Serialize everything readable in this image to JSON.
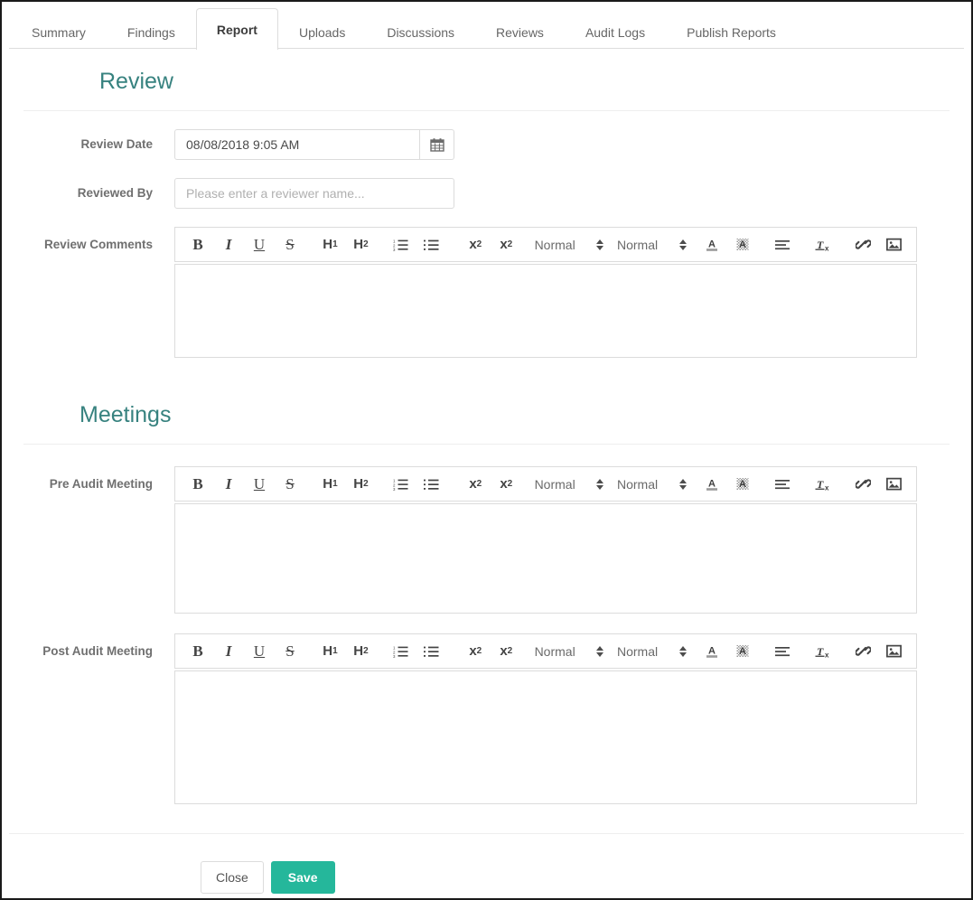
{
  "tabs": [
    {
      "label": "Summary",
      "active": false
    },
    {
      "label": "Findings",
      "active": false
    },
    {
      "label": "Report",
      "active": true
    },
    {
      "label": "Uploads",
      "active": false
    },
    {
      "label": "Discussions",
      "active": false
    },
    {
      "label": "Reviews",
      "active": false
    },
    {
      "label": "Audit Logs",
      "active": false
    },
    {
      "label": "Publish Reports",
      "active": false
    }
  ],
  "review_section": {
    "title": "Review",
    "review_date": {
      "label": "Review Date",
      "value": "08/08/2018 9:05 AM",
      "calendar_icon": "calendar-icon"
    },
    "reviewed_by": {
      "label": "Reviewed By",
      "value": "",
      "placeholder": "Please enter a reviewer name..."
    },
    "review_comments": {
      "label": "Review Comments",
      "value": ""
    }
  },
  "meetings_section": {
    "title": "Meetings",
    "pre_audit_meeting": {
      "label": "Pre Audit Meeting",
      "value": ""
    },
    "post_audit_meeting": {
      "label": "Post Audit Meeting",
      "value": ""
    }
  },
  "editor_toolbar": {
    "bold": "B",
    "italic": "I",
    "underline": "U",
    "strikethrough": "S",
    "heading1": "H",
    "heading1_sub": "1",
    "heading2": "H",
    "heading2_sub": "2",
    "ordered_list": "ordered-list-icon",
    "bullet_list": "bullet-list-icon",
    "subscript": "x",
    "subscript_sub": "2",
    "superscript": "x",
    "superscript_sup": "2",
    "font_size_select": "Normal",
    "font_family_select": "Normal",
    "text_color": "A",
    "background_color": "A",
    "align": "align-icon",
    "clear_format": "T",
    "clear_format_sub": "x",
    "link": "link-icon",
    "image": "image-icon"
  },
  "footer": {
    "close_label": "Close",
    "save_label": "Save"
  },
  "colors": {
    "accent_teal": "#37827f",
    "primary_button": "#25b79b",
    "border": "#dcdcdc",
    "label_text": "#6f6f6f"
  }
}
